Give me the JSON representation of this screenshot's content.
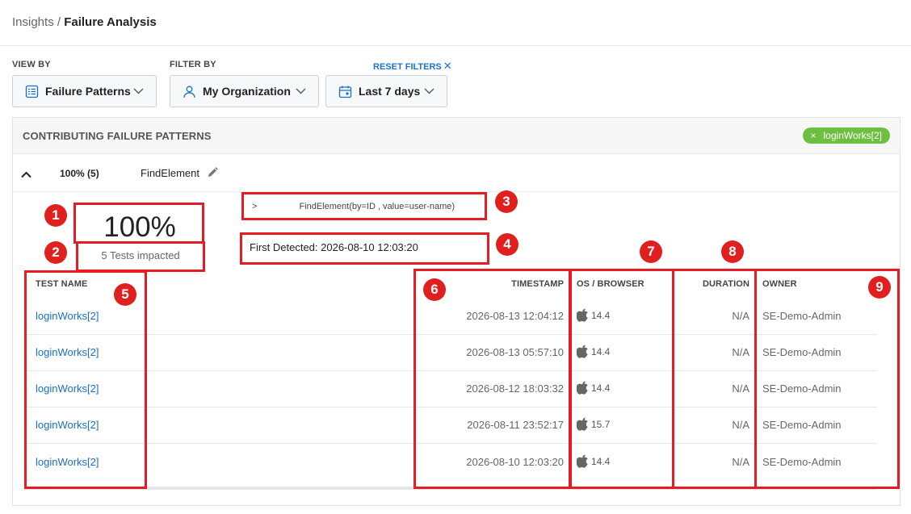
{
  "breadcrumb": {
    "parent": "Insights",
    "separator": " / ",
    "current": "Failure Analysis"
  },
  "filters": {
    "view_by_label": "VIEW BY",
    "filter_by_label": "FILTER BY",
    "reset_label": "RESET FILTERS",
    "reset_icon": "✕",
    "view_by_value": "Failure Patterns",
    "org_value": "My Organization",
    "date_value": "Last 7 days"
  },
  "panel": {
    "title": "CONTRIBUTING FAILURE PATTERNS",
    "tag_label": "loginWorks[2]",
    "tag_icon": "×"
  },
  "pattern": {
    "percent_count": "100% (5)",
    "name": "FindElement",
    "big_percent": "100%",
    "tests_impacted": "5 Tests impacted",
    "signature_prefix": ">",
    "signature": "FindElement(by=ID , value=user-name)",
    "first_detected": "First Detected: 2026-08-10 12:03:20"
  },
  "table": {
    "headers": {
      "test_name": "TEST NAME",
      "timestamp": "TIMESTAMP",
      "os_browser": "OS / BROWSER",
      "duration": "DURATION",
      "owner": "OWNER"
    },
    "rows": [
      {
        "test_name": "loginWorks[2]",
        "timestamp": "2026-08-13 12:04:12",
        "os_icon": "apple-icon",
        "os_version": "14.4",
        "duration": "N/A",
        "owner": "SE-Demo-Admin"
      },
      {
        "test_name": "loginWorks[2]",
        "timestamp": "2026-08-13 05:57:10",
        "os_icon": "apple-icon",
        "os_version": "14.4",
        "duration": "N/A",
        "owner": "SE-Demo-Admin"
      },
      {
        "test_name": "loginWorks[2]",
        "timestamp": "2026-08-12 18:03:32",
        "os_icon": "apple-icon",
        "os_version": "14.4",
        "duration": "N/A",
        "owner": "SE-Demo-Admin"
      },
      {
        "test_name": "loginWorks[2]",
        "timestamp": "2026-08-11 23:52:17",
        "os_icon": "apple-icon",
        "os_version": "15.7",
        "duration": "N/A",
        "owner": "SE-Demo-Admin"
      },
      {
        "test_name": "loginWorks[2]",
        "timestamp": "2026-08-10 12:03:20",
        "os_icon": "apple-icon",
        "os_version": "14.4",
        "duration": "N/A",
        "owner": "SE-Demo-Admin"
      }
    ]
  },
  "annotations": [
    "1",
    "2",
    "3",
    "4",
    "5",
    "6",
    "7",
    "8",
    "9"
  ],
  "colors": {
    "link": "#1a6fc2",
    "tag": "#6dbf3f",
    "annotation": "#e51c23"
  }
}
